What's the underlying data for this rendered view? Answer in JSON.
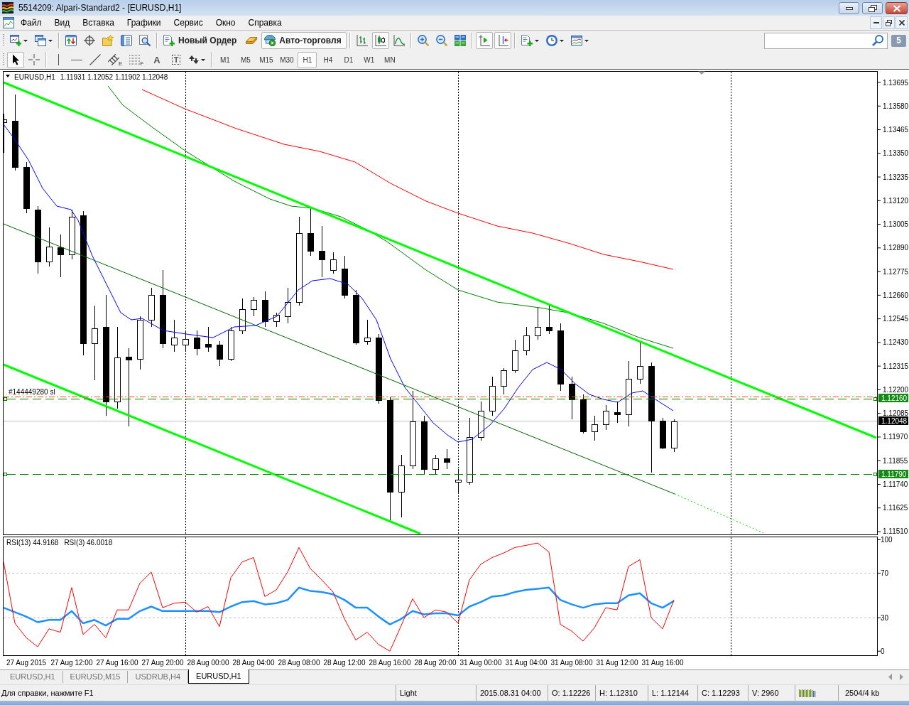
{
  "window": {
    "title": "5514209: Alpari-Standard2 - [EURUSD,H1]"
  },
  "menu": [
    {
      "label": "Файл"
    },
    {
      "label": "Вид"
    },
    {
      "label": "Вставка"
    },
    {
      "label": "Графики"
    },
    {
      "label": "Сервис"
    },
    {
      "label": "Окно"
    },
    {
      "label": "Справка"
    }
  ],
  "toolbar": [
    {
      "kind": "new-chart",
      "dropdown": true
    },
    {
      "kind": "profiles",
      "dropdown": true
    },
    {
      "kind": "separator"
    },
    {
      "kind": "market-watch"
    },
    {
      "kind": "data-window"
    },
    {
      "kind": "navigator"
    },
    {
      "kind": "terminal"
    },
    {
      "kind": "tester"
    },
    {
      "kind": "separator"
    },
    {
      "kind": "new-order",
      "label": "Новый Ордер"
    },
    {
      "kind": "editor"
    },
    {
      "kind": "autotrading",
      "label": "Авто-торговля",
      "on": true
    },
    {
      "kind": "separator"
    },
    {
      "kind": "bar-chart",
      "selected": false
    },
    {
      "kind": "candle-chart",
      "selected": true
    },
    {
      "kind": "line-chart",
      "selected": false
    },
    {
      "kind": "separator"
    },
    {
      "kind": "zoom-in"
    },
    {
      "kind": "zoom-out"
    },
    {
      "kind": "tile"
    },
    {
      "kind": "separator"
    },
    {
      "kind": "autoscroll",
      "on": true
    },
    {
      "kind": "chart-shift",
      "on": true
    },
    {
      "kind": "separator"
    },
    {
      "kind": "indicators",
      "dropdown": true
    },
    {
      "kind": "periods",
      "dropdown": true
    },
    {
      "kind": "templates",
      "dropdown": true
    }
  ],
  "messages": {
    "count": "5"
  },
  "draw_tools": [
    {
      "kind": "cursor",
      "selected": true
    },
    {
      "kind": "crosshair",
      "selected": false
    },
    {
      "kind": "vertical-line",
      "selected": false
    },
    {
      "kind": "horizontal-line",
      "selected": false
    },
    {
      "kind": "trendline",
      "selected": false
    },
    {
      "kind": "channel",
      "label": "E",
      "selected": false
    },
    {
      "kind": "fibonacci",
      "label": "F",
      "selected": false
    },
    {
      "kind": "text",
      "label": "A",
      "selected": false
    },
    {
      "kind": "text-label",
      "label": "T",
      "selected": false
    },
    {
      "kind": "arrows",
      "dropdown": true,
      "selected": false
    }
  ],
  "periods": [
    {
      "label": "M1",
      "selected": false
    },
    {
      "label": "M5",
      "selected": false
    },
    {
      "label": "M15",
      "selected": false
    },
    {
      "label": "M30",
      "selected": false
    },
    {
      "label": "H1",
      "selected": true
    },
    {
      "label": "H4",
      "selected": false
    },
    {
      "label": "D1",
      "selected": false
    },
    {
      "label": "W1",
      "selected": false
    },
    {
      "label": "MN",
      "selected": false
    }
  ],
  "chart": {
    "symbol": "EURUSD,H1",
    "quote": "1.11931 1.12052 1.11902 1.12048",
    "order_label": "#144449280 sl",
    "price_axis": [
      "1.13695",
      "1.13580",
      "1.13465",
      "1.13350",
      "1.13235",
      "1.13120",
      "1.13005",
      "1.12890",
      "1.12775",
      "1.12660",
      "1.12545",
      "1.12430",
      "1.12315",
      "1.12200",
      "1.12085",
      "1.11970",
      "1.11855",
      "1.11740",
      "1.11625",
      "1.11510"
    ],
    "price_tags": [
      {
        "kind": "order",
        "label": "1.12160"
      },
      {
        "kind": "bid",
        "label": "1.12048"
      },
      {
        "kind": "order",
        "label": "1.11790"
      }
    ]
  },
  "indicator": {
    "readings": [
      "44.9168",
      "46.0018"
    ],
    "chart_data": {
      "type": "line",
      "categories": [
        null,
        null,
        "27 Aug 2015",
        null,
        null,
        null,
        "27 Aug 12:00",
        null,
        null,
        null,
        "27 Aug 16:00",
        null,
        null,
        null,
        "27 Aug 20:00",
        null,
        null,
        null,
        "28 Aug 00:00",
        null,
        null,
        null,
        "28 Aug 04:00",
        null,
        null,
        null,
        "28 Aug 08:00",
        null,
        null,
        null,
        "28 Aug 12:00",
        null,
        null,
        null,
        "28 Aug 16:00",
        null,
        null,
        null,
        "28 Aug 20:00",
        null,
        null,
        null,
        "31 Aug 00:00",
        null,
        null,
        null,
        "31 Aug 04:00",
        null,
        null,
        null,
        "31 Aug 08:00",
        null,
        null,
        null,
        "31 Aug 12:00",
        null,
        null,
        null,
        "31 Aug 16:00",
        null,
        null,
        null,
        null,
        null,
        null,
        null,
        null,
        null,
        null,
        null,
        null,
        null,
        null,
        null,
        null,
        null,
        null
      ],
      "series": [
        {
          "name": "RSI(13)",
          "color": "#1e90ff",
          "values": [
            39,
            35,
            31,
            26,
            28,
            28,
            36,
            25,
            28,
            23,
            29,
            29,
            36,
            40,
            36,
            36,
            36,
            36,
            36,
            35,
            40,
            44,
            45,
            42,
            43,
            46,
            57,
            54,
            53,
            51,
            46,
            39,
            39,
            31,
            24,
            29,
            36,
            33,
            34,
            34,
            32,
            40,
            44,
            49,
            50,
            53,
            55,
            56,
            57,
            46,
            42,
            39,
            42,
            43,
            43,
            50,
            52,
            43,
            39,
            45,
            null,
            null,
            null,
            null,
            null,
            null,
            null,
            null,
            null,
            null,
            null,
            null,
            null,
            null,
            null,
            null,
            null
          ]
        },
        {
          "name": "RSI(3)",
          "color": "#ff0000",
          "values": [
            80,
            25,
            12,
            4,
            20,
            17,
            57,
            15,
            24,
            12,
            37,
            37,
            61,
            71,
            39,
            43,
            44,
            35,
            40,
            22,
            66,
            80,
            84,
            49,
            55,
            71,
            93,
            74,
            64,
            53,
            29,
            10,
            17,
            6,
            0,
            23,
            47,
            30,
            37,
            35,
            25,
            64,
            78,
            84,
            88,
            93,
            95,
            97,
            89,
            24,
            18,
            9,
            21,
            39,
            37,
            76,
            82,
            30,
            20,
            46,
            null,
            null,
            null,
            null,
            null,
            null,
            null,
            null,
            null,
            null,
            null,
            null,
            null,
            null,
            null,
            null,
            null
          ]
        }
      ],
      "ylim": [
        -4,
        102.5
      ],
      "yticks": [
        0,
        30,
        70,
        100
      ],
      "grid": true
    }
  },
  "chart_tabs": [
    {
      "label": "EURUSD,H1",
      "selected": false
    },
    {
      "label": "EURUSD,M15",
      "selected": false
    },
    {
      "label": "USDRUB,H4",
      "selected": false
    },
    {
      "label": "EURUSD,H1",
      "selected": true
    }
  ],
  "status_bar": {
    "help": "Для справки, нажмите F1",
    "profile": "Light",
    "time": "2015.08.31 04:00",
    "open": "O: 1.12226",
    "high": "H: 1.12310",
    "low": "L: 1.12144",
    "close": "C: 1.12293",
    "volume": "V: 2960",
    "traffic": "2504/4 kb"
  }
}
